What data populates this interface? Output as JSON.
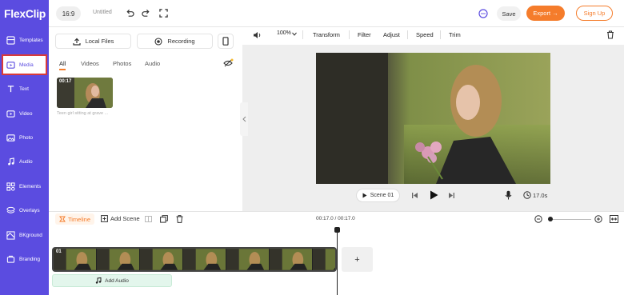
{
  "brand": {
    "logo_text": "FlexClip",
    "accent": "#5b4ce0",
    "orange": "#f57c2b"
  },
  "sidebar": {
    "items": [
      {
        "label": "Templates",
        "icon": "templates-icon"
      },
      {
        "label": "Media",
        "icon": "media-icon",
        "active": true
      },
      {
        "label": "Text",
        "icon": "text-icon"
      },
      {
        "label": "Video",
        "icon": "video-icon"
      },
      {
        "label": "Photo",
        "icon": "photo-icon"
      },
      {
        "label": "Audio",
        "icon": "audio-icon"
      },
      {
        "label": "Elements",
        "icon": "elements-icon"
      },
      {
        "label": "Overlays",
        "icon": "overlays-icon"
      },
      {
        "label": "BKground",
        "icon": "background-icon"
      },
      {
        "label": "Branding",
        "icon": "branding-icon"
      }
    ]
  },
  "topbar": {
    "ratio": "16:9",
    "doc_title": "Untitled",
    "save_label": "Save",
    "export_label": "Export →",
    "signup_label": "Sign Up"
  },
  "media": {
    "local_files_label": "Local Files",
    "recording_label": "Recording",
    "tabs": [
      "All",
      "Videos",
      "Photos",
      "Audio"
    ],
    "thumb_time": "00:17",
    "thumb_caption": "Teen girl sitting at grave ..."
  },
  "edit_toolbar": {
    "volume_percent": "100%",
    "items": [
      "Transform",
      "Filter",
      "Adjust",
      "Speed",
      "Trim"
    ]
  },
  "preview": {
    "scene_label": "Scene 01",
    "duration": "17.0s"
  },
  "timeline": {
    "tab_label": "Timeline",
    "add_scene_label": "Add Scene",
    "time_display": "00:17.0 / 00:17.0",
    "clip_number": "01",
    "add_audio_label": "Add Audio",
    "add_clip_symbol": "+",
    "zoom_level": 0.05
  }
}
